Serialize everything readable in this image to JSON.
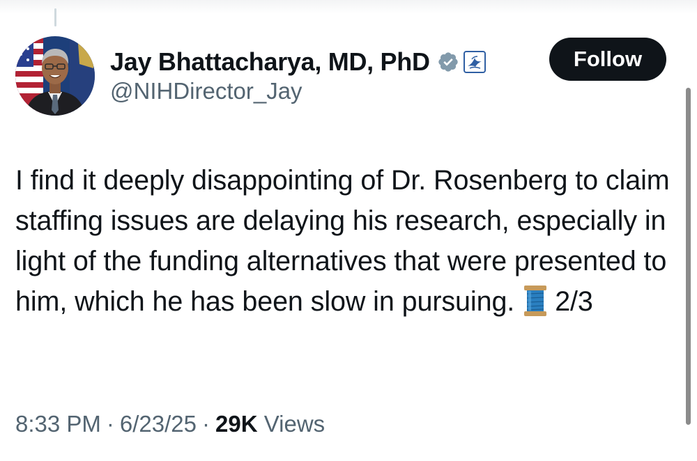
{
  "tweet": {
    "author": {
      "display_name": "Jay Bhattacharya, MD, PhD",
      "handle": "@NIHDirector_Jay",
      "verified": true,
      "affiliate_badge": "hhs-eagle-icon"
    },
    "follow_label": "Follow",
    "text": "I find it deeply disappointing of Dr. Rosenberg to claim staffing issues are delaying his research, especially in light of the funding alternatives that were presented to him, which he has been slow in pursuing.",
    "text_emoji": "spool-of-thread-icon",
    "thread_counter": "2/3",
    "time": "8:33 PM",
    "date": "6/23/25",
    "separator": "·",
    "views_count": "29K",
    "views_label": "Views"
  },
  "colors": {
    "text_primary": "#0f1419",
    "text_secondary": "#536471",
    "verified_gray": "#829aab",
    "follow_bg": "#0f1419",
    "follow_text": "#ffffff",
    "affiliate_blue": "#2f5fa3"
  }
}
